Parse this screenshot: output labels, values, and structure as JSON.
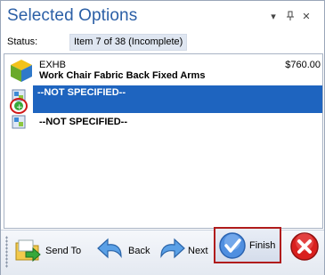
{
  "panel": {
    "title": "Selected Options",
    "controls": {
      "dropdown_icon": "dropdown-arrow-icon",
      "pin_icon": "pin-icon",
      "close_icon": "close-icon"
    }
  },
  "status": {
    "label": "Status:",
    "value": "Item 7 of 38 (Incomplete)"
  },
  "items": [
    {
      "code": "EXHB",
      "name": "Work Chair Fabric Back Fixed Arms",
      "price": "$760.00",
      "icon": "chair-cube-icon"
    },
    {
      "name": "--NOT SPECIFIED--",
      "selected": true,
      "icon": "option-add-icon"
    },
    {
      "name": "--NOT SPECIFIED--",
      "selected": false,
      "icon": "option-icon"
    }
  ],
  "toolbar": {
    "send_to": "Send To",
    "back": "Back",
    "next": "Next",
    "finish": "Finish",
    "cancel_icon": "cancel-icon"
  },
  "colors": {
    "title": "#2b5fa6",
    "selection": "#1e64bf",
    "highlight_border": "#b01c1c"
  }
}
